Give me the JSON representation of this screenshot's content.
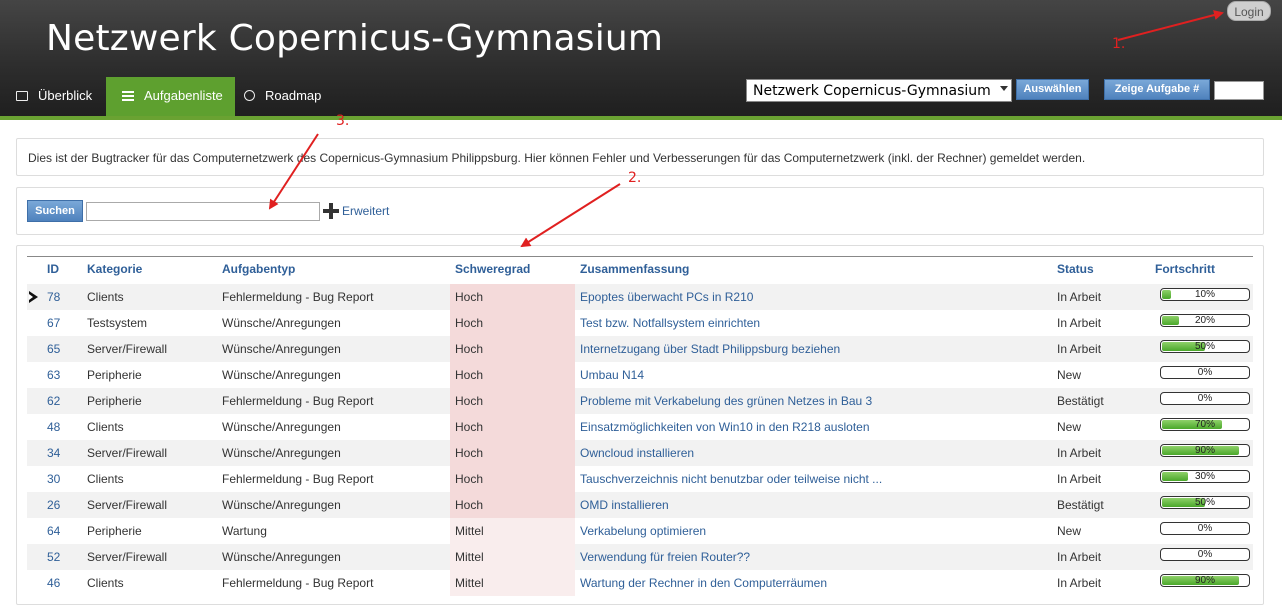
{
  "header": {
    "title": "Netzwerk Copernicus-Gymnasium",
    "login_label": "Login",
    "nav": [
      {
        "label": "Überblick",
        "icon": "folder-icon",
        "active": false
      },
      {
        "label": "Aufgabenliste",
        "icon": "list-icon",
        "active": true
      },
      {
        "label": "Roadmap",
        "icon": "clock-icon",
        "active": false
      }
    ],
    "project_select_value": "Netzwerk Copernicus-Gymnasium",
    "choose_label": "Auswählen",
    "show_task_label": "Zeige Aufgabe #",
    "task_number_value": ""
  },
  "info_text": "Dies ist der Bugtracker für das Computernetzwerk des Copernicus-Gymnasium Philippsburg. Hier können Fehler und Verbesserungen für das Computernetzwerk (inkl. der Rechner) gemeldet werden.",
  "search": {
    "button_label": "Suchen",
    "input_value": "",
    "advanced_label": "Erweitert"
  },
  "table": {
    "columns": [
      "ID",
      "Kategorie",
      "Aufgabentyp",
      "Schweregrad",
      "Zusammenfassung",
      "Status",
      "Fortschritt"
    ],
    "rows": [
      {
        "id": "78",
        "kategorie": "Clients",
        "typ": "Fehlermeldung - Bug Report",
        "schwere": "Hoch",
        "summary": "Epoptes überwacht PCs in R210",
        "status": "In Arbeit",
        "progress": 10,
        "progress_label": "10%"
      },
      {
        "id": "67",
        "kategorie": "Testsystem",
        "typ": "Wünsche/Anregungen",
        "schwere": "Hoch",
        "summary": "Test bzw. Notfallsystem einrichten",
        "status": "In Arbeit",
        "progress": 20,
        "progress_label": "20%"
      },
      {
        "id": "65",
        "kategorie": "Server/Firewall",
        "typ": "Wünsche/Anregungen",
        "schwere": "Hoch",
        "summary": "Internetzugang über Stadt Philippsburg beziehen",
        "status": "In Arbeit",
        "progress": 50,
        "progress_label": "50%"
      },
      {
        "id": "63",
        "kategorie": "Peripherie",
        "typ": "Wünsche/Anregungen",
        "schwere": "Hoch",
        "summary": "Umbau N14",
        "status": "New",
        "progress": 0,
        "progress_label": "0%"
      },
      {
        "id": "62",
        "kategorie": "Peripherie",
        "typ": "Fehlermeldung - Bug Report",
        "schwere": "Hoch",
        "summary": "Probleme mit Verkabelung des grünen Netzes in Bau 3",
        "status": "Bestätigt",
        "progress": 0,
        "progress_label": "0%"
      },
      {
        "id": "48",
        "kategorie": "Clients",
        "typ": "Wünsche/Anregungen",
        "schwere": "Hoch",
        "summary": "Einsatzmöglichkeiten von Win10 in den R218 ausloten",
        "status": "New",
        "progress": 70,
        "progress_label": "70%"
      },
      {
        "id": "34",
        "kategorie": "Server/Firewall",
        "typ": "Wünsche/Anregungen",
        "schwere": "Hoch",
        "summary": "Owncloud installieren",
        "status": "In Arbeit",
        "progress": 90,
        "progress_label": "90%"
      },
      {
        "id": "30",
        "kategorie": "Clients",
        "typ": "Fehlermeldung - Bug Report",
        "schwere": "Hoch",
        "summary": "Tauschverzeichnis nicht benutzbar oder teilweise nicht ...",
        "status": "In Arbeit",
        "progress": 30,
        "progress_label": "30%"
      },
      {
        "id": "26",
        "kategorie": "Server/Firewall",
        "typ": "Wünsche/Anregungen",
        "schwere": "Hoch",
        "summary": "OMD installieren",
        "status": "Bestätigt",
        "progress": 50,
        "progress_label": "50%"
      },
      {
        "id": "64",
        "kategorie": "Peripherie",
        "typ": "Wartung",
        "schwere": "Mittel",
        "summary": "Verkabelung optimieren",
        "status": "New",
        "progress": 0,
        "progress_label": "0%"
      },
      {
        "id": "52",
        "kategorie": "Server/Firewall",
        "typ": "Wünsche/Anregungen",
        "schwere": "Mittel",
        "summary": "Verwendung für freien Router??",
        "status": "In Arbeit",
        "progress": 0,
        "progress_label": "0%"
      },
      {
        "id": "46",
        "kategorie": "Clients",
        "typ": "Fehlermeldung - Bug Report",
        "schwere": "Mittel",
        "summary": "Wartung der Rechner in den Computerräumen",
        "status": "In Arbeit",
        "progress": 90,
        "progress_label": "90%"
      }
    ]
  },
  "annotations": [
    "1.",
    "2.",
    "3."
  ],
  "colors": {
    "accent_green": "#5ea02f",
    "link_blue": "#2f5f98",
    "severity_hoch": "#f4dada",
    "severity_mittel": "#f9eded",
    "annotation_red": "#e02020"
  }
}
